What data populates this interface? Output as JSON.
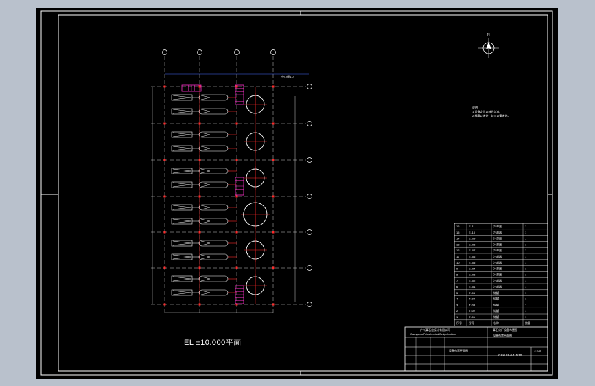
{
  "drawing": {
    "plan_title": "EL ±10.000平面",
    "notes": {
      "heading": "说明",
      "lines": [
        "1.设备定位以轴线为准。",
        "2.标高以米计，其余以毫米计。"
      ]
    },
    "compass": {
      "label": "N"
    },
    "top_dimension_note": "中心线1.0"
  },
  "title_block": {
    "company": "广州某石化设计有限公司",
    "company_en": "Guangzhou Petrochemical Design Institute",
    "project": "某石化厂设备布置图",
    "drawing_title": "设备布置平面图",
    "drawing_no": "GSH 15-0-1-1/10",
    "scale": "1:100"
  },
  "equipment_list": {
    "rows": [
      {
        "no": "16",
        "tag": "E111",
        "name": "冷却器",
        "qty": "1"
      },
      {
        "no": "15",
        "tag": "E110",
        "name": "冷却器",
        "qty": "1"
      },
      {
        "no": "14",
        "tag": "E109",
        "name": "冷却器",
        "qty": "1"
      },
      {
        "no": "13",
        "tag": "E108",
        "name": "冷却器",
        "qty": "1"
      },
      {
        "no": "12",
        "tag": "E107",
        "name": "冷却器",
        "qty": "1"
      },
      {
        "no": "11",
        "tag": "E106",
        "name": "冷却器",
        "qty": "1"
      },
      {
        "no": "10",
        "tag": "E105",
        "name": "冷却器",
        "qty": "1"
      },
      {
        "no": "9",
        "tag": "E104",
        "name": "冷却器",
        "qty": "1"
      },
      {
        "no": "8",
        "tag": "E103",
        "name": "冷却器",
        "qty": "1"
      },
      {
        "no": "7",
        "tag": "E102",
        "name": "冷却器",
        "qty": "1"
      },
      {
        "no": "6",
        "tag": "E101",
        "name": "冷却器",
        "qty": "1"
      },
      {
        "no": "5",
        "tag": "T105",
        "name": "储罐",
        "qty": "1"
      },
      {
        "no": "4",
        "tag": "T104",
        "name": "储罐",
        "qty": "1"
      },
      {
        "no": "3",
        "tag": "T103",
        "name": "储罐",
        "qty": "1"
      },
      {
        "no": "2",
        "tag": "T102",
        "name": "储罐",
        "qty": "1"
      },
      {
        "no": "1",
        "tag": "T101",
        "name": "储罐",
        "qty": "1"
      }
    ],
    "header": {
      "no": "序号",
      "tag": "位号",
      "name": "名称",
      "qty": "数量"
    }
  }
}
